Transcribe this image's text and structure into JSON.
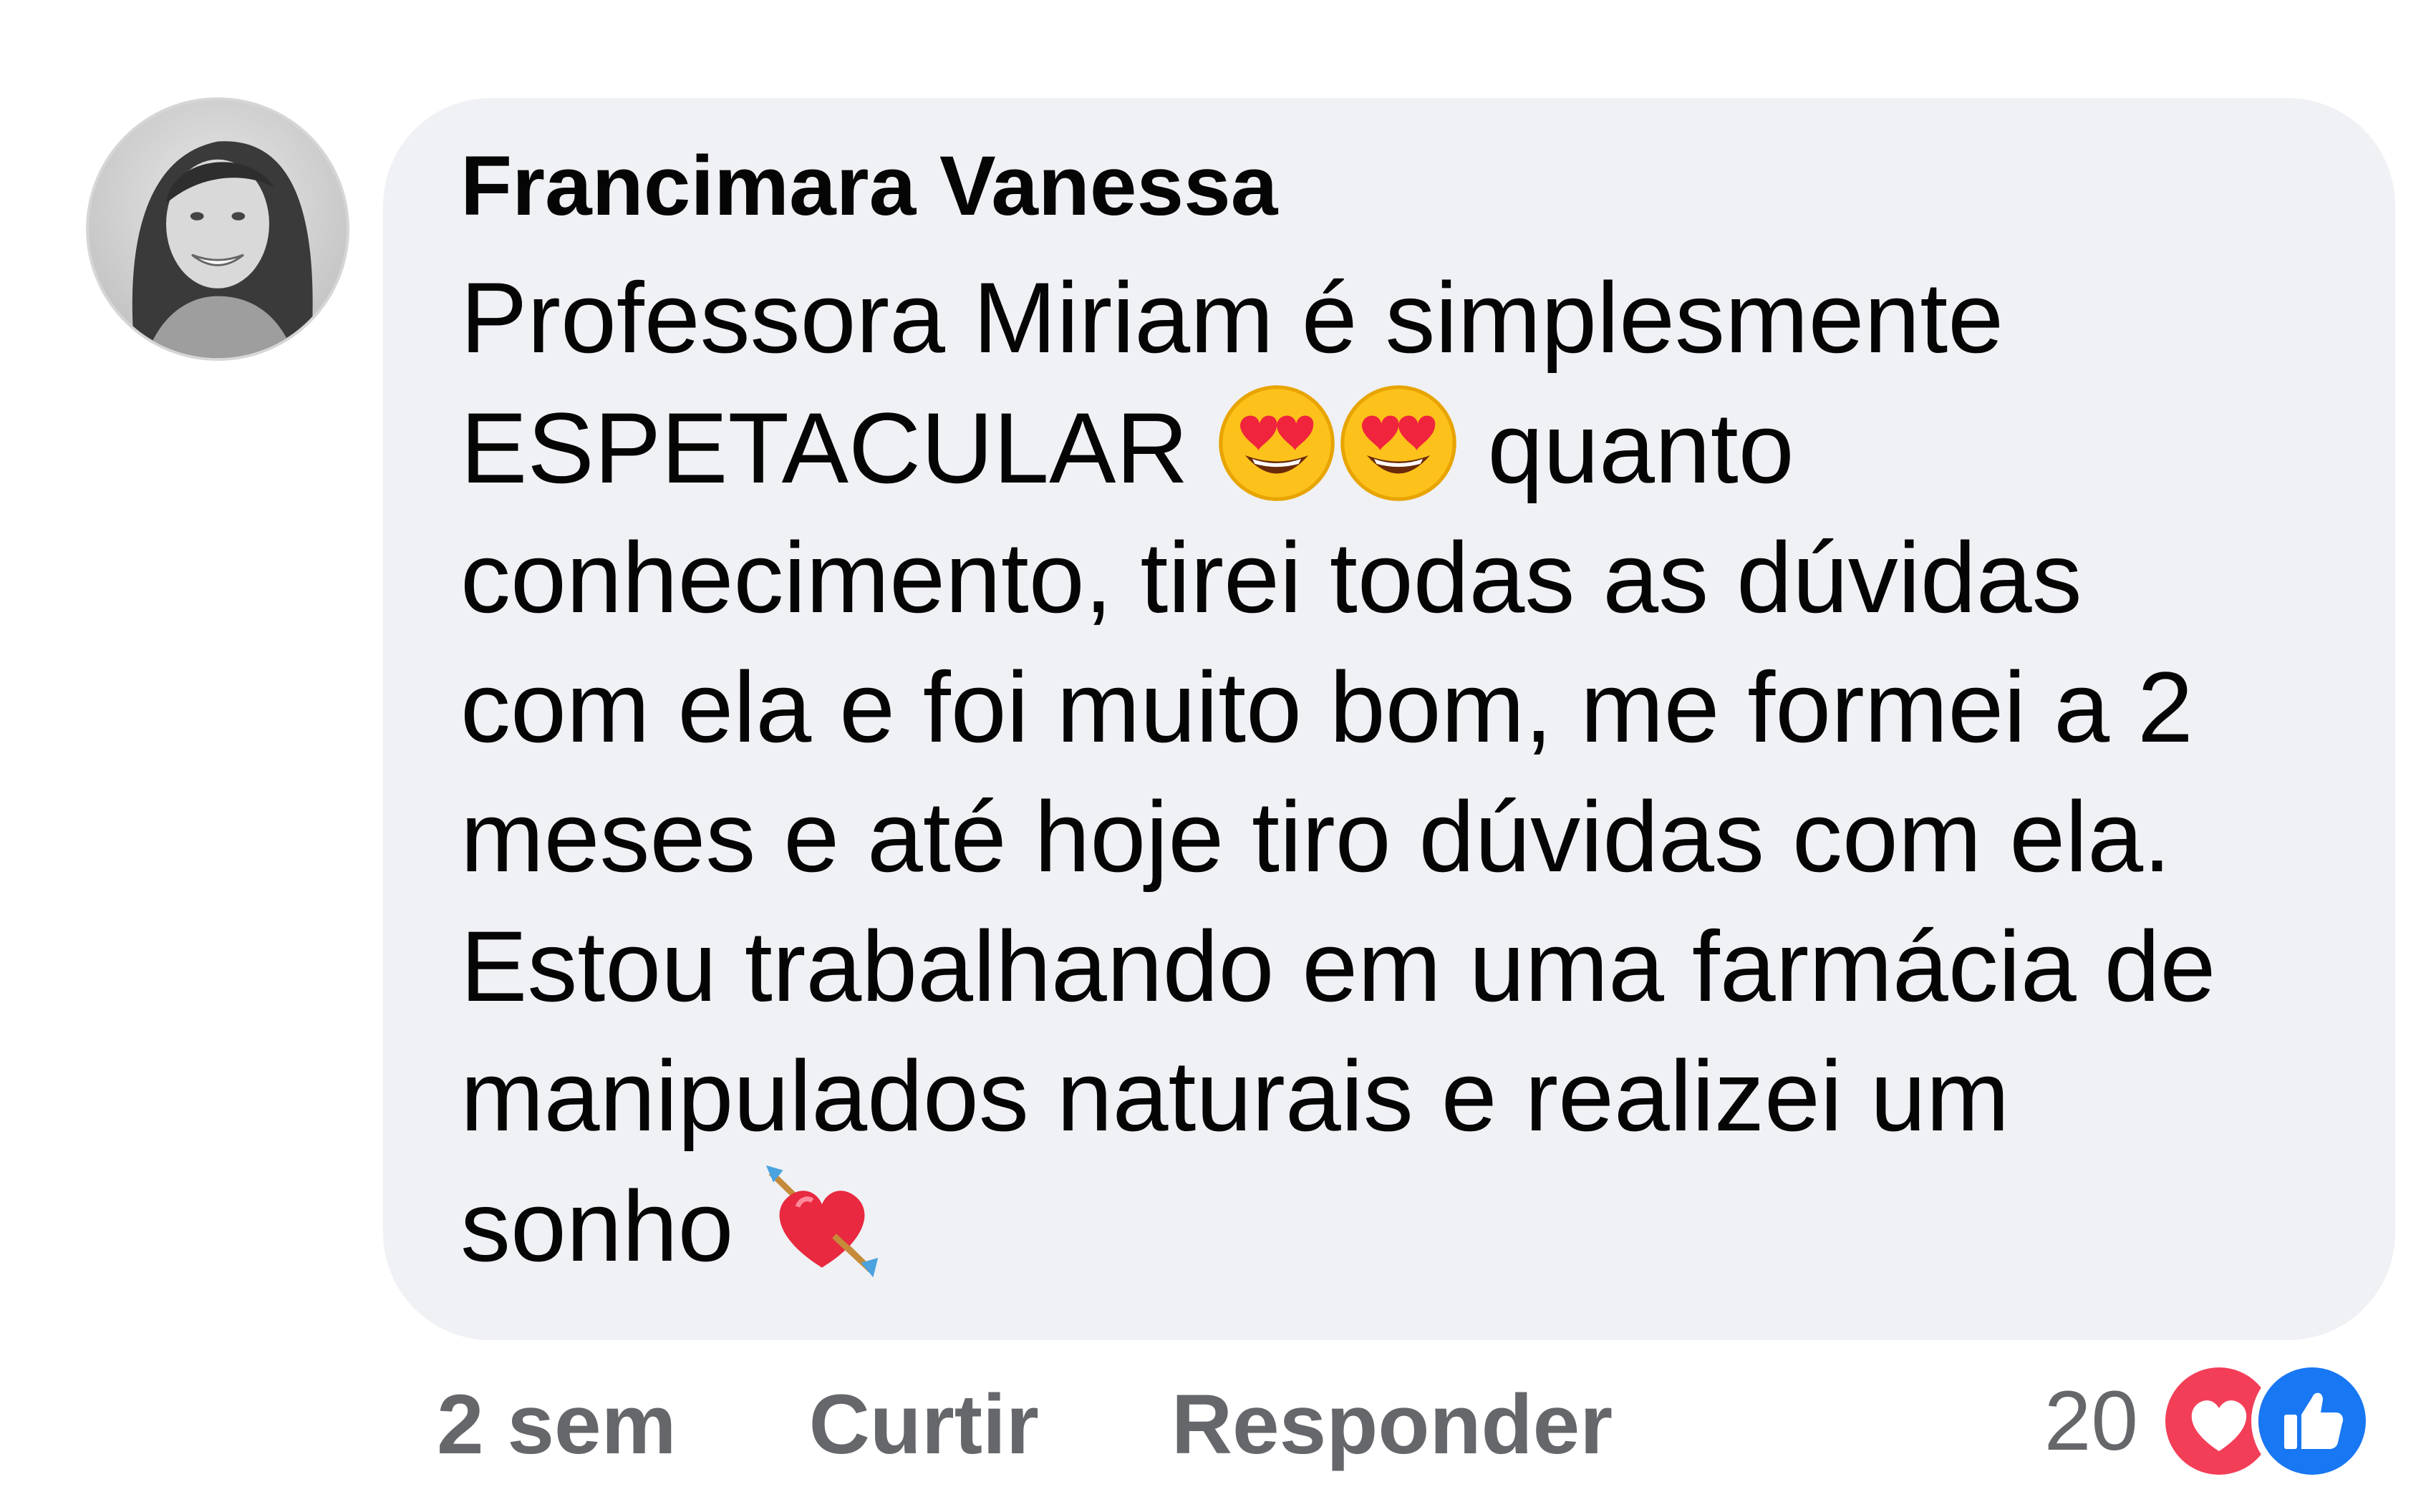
{
  "comment": {
    "author": "Francimara Vanessa",
    "lines": [
      {
        "text": "Professora Miriam é simplesmente",
        "suffix": ""
      },
      {
        "text": "ESPETACULAR",
        "emojis": [
          "heart-eyes",
          "heart-eyes"
        ],
        "suffix": "quanto"
      },
      {
        "text": "conhecimento, tirei todas as dúvidas"
      },
      {
        "text": "com ela e foi muito bom, me formei a 2"
      },
      {
        "text": "meses e até hoje tiro dúvidas com ela."
      },
      {
        "text": "Estou trabalhando em uma farmácia de"
      },
      {
        "text": "manipulados naturais e realizei um"
      },
      {
        "text": "sonho",
        "emojis": [
          "heart-with-arrow"
        ]
      }
    ]
  },
  "actions": {
    "time": "2 sem",
    "like_label": "Curtir",
    "reply_label": "Responder"
  },
  "reactions": {
    "count": "20",
    "icons": [
      "love-reaction",
      "like-reaction"
    ],
    "love_color": "#f33e58",
    "like_color": "#1877f2"
  },
  "colors": {
    "bubble": "#f0f1f5",
    "text": "#050505",
    "secondary": "#65676b"
  }
}
